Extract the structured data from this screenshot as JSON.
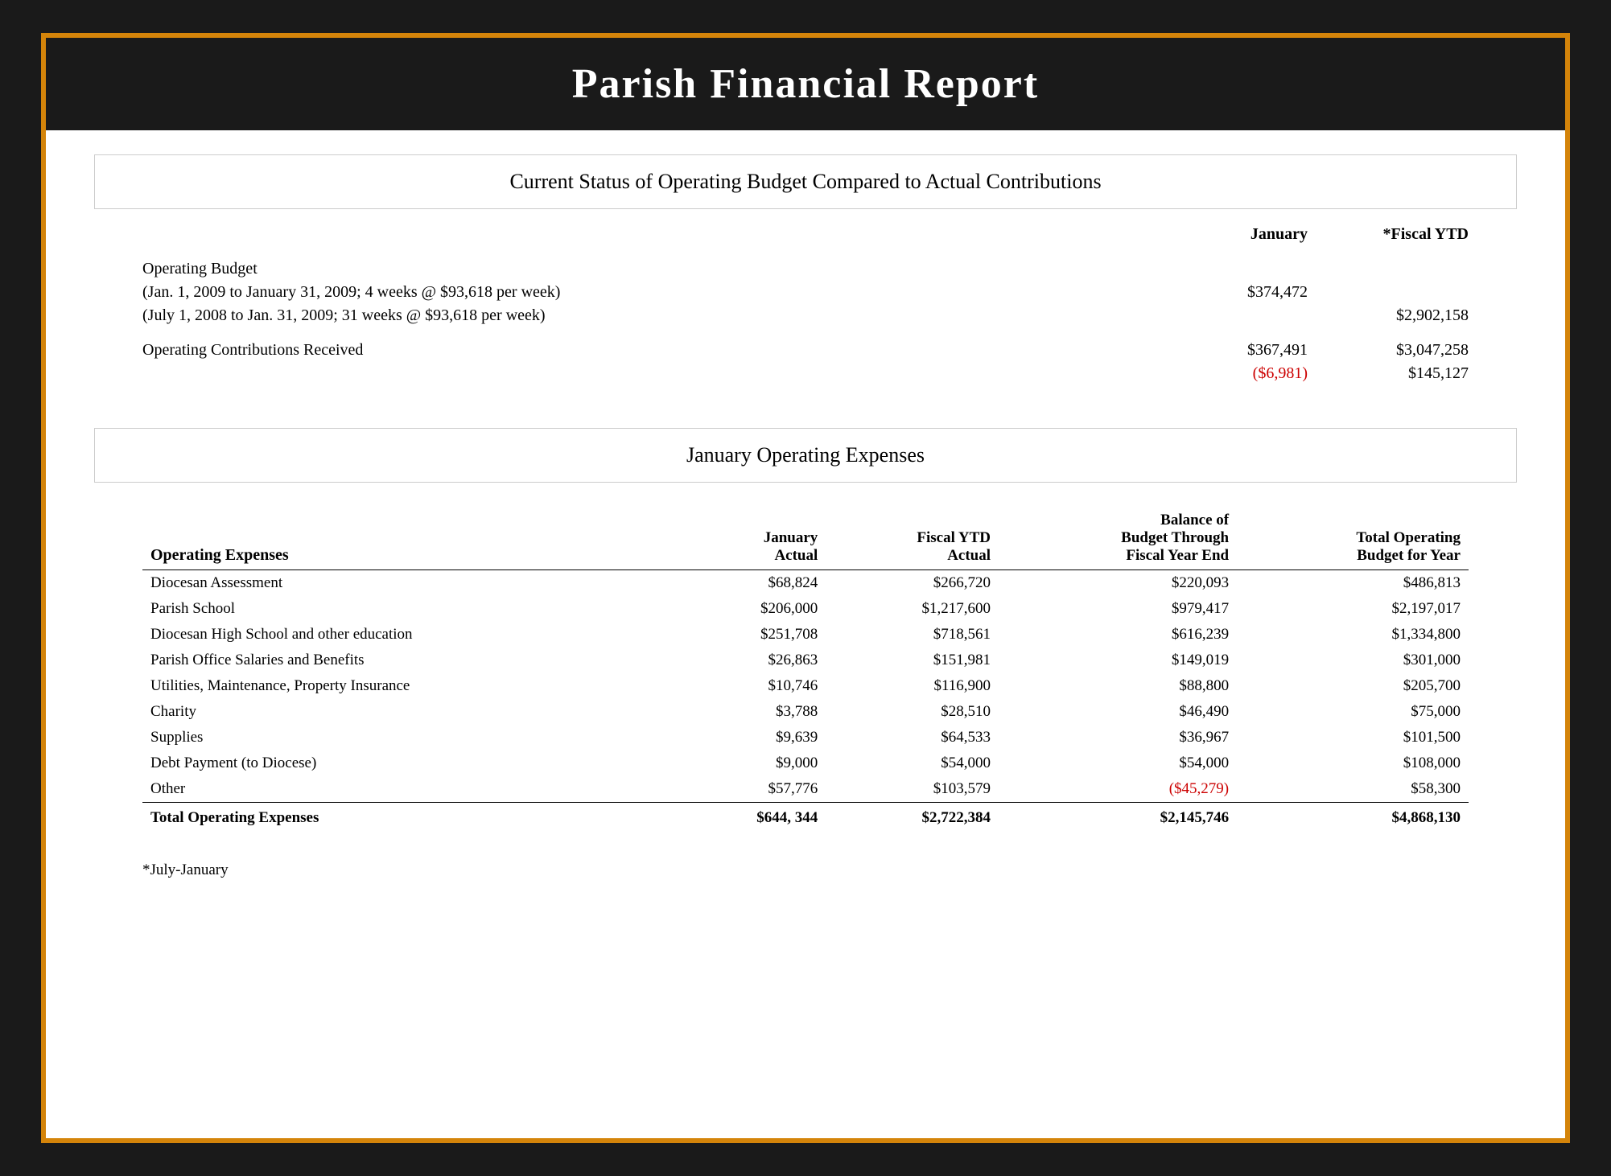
{
  "title": "Parish Financial Report",
  "section1": {
    "title": "Current Status of Operating Budget Compared to Actual Contributions",
    "col_jan": "January",
    "col_ytd": "*Fiscal YTD",
    "operating_budget_label": "Operating Budget",
    "op_line1": "(Jan. 1, 2009 to January 31, 2009; 4 weeks @ $93,618 per week)",
    "op_line1_jan": "$374,472",
    "op_line2": "(July 1, 2008 to Jan. 31, 2009; 31 weeks @ $93,618 per week)",
    "op_line2_ytd": "$2,902,158",
    "contrib_label": "Operating Contributions Received",
    "contrib_jan": "$367,491",
    "contrib_jan_diff": "($6,981)",
    "contrib_ytd": "$3,047,258",
    "contrib_ytd_diff": "$145,127"
  },
  "section2": {
    "title": "January Operating Expenses"
  },
  "expenses_table": {
    "col1": "Operating Expenses",
    "col2_line1": "January",
    "col2_line2": "Actual",
    "col3_line1": "Fiscal YTD",
    "col3_line2": "Actual",
    "col4_line1": "Balance of",
    "col4_line2": "Budget Through",
    "col4_line3": "Fiscal Year End",
    "col5_line1": "Total Operating",
    "col5_line2": "Budget for Year",
    "rows": [
      {
        "label": "Diocesan Assessment",
        "jan_actual": "$68,824",
        "fiscal_ytd": "$266,720",
        "balance": "$220,093",
        "total_budget": "$486,813",
        "balance_red": false
      },
      {
        "label": "Parish School",
        "jan_actual": "$206,000",
        "fiscal_ytd": "$1,217,600",
        "balance": "$979,417",
        "total_budget": "$2,197,017",
        "balance_red": false
      },
      {
        "label": "Diocesan High School and other education",
        "jan_actual": "$251,708",
        "fiscal_ytd": "$718,561",
        "balance": "$616,239",
        "total_budget": "$1,334,800",
        "balance_red": false
      },
      {
        "label": "Parish Office Salaries and Benefits",
        "jan_actual": "$26,863",
        "fiscal_ytd": "$151,981",
        "balance": "$149,019",
        "total_budget": "$301,000",
        "balance_red": false
      },
      {
        "label": "Utilities, Maintenance, Property Insurance",
        "jan_actual": "$10,746",
        "fiscal_ytd": "$116,900",
        "balance": "$88,800",
        "total_budget": "$205,700",
        "balance_red": false
      },
      {
        "label": "Charity",
        "jan_actual": "$3,788",
        "fiscal_ytd": "$28,510",
        "balance": "$46,490",
        "total_budget": "$75,000",
        "balance_red": false
      },
      {
        "label": "Supplies",
        "jan_actual": "$9,639",
        "fiscal_ytd": "$64,533",
        "balance": "$36,967",
        "total_budget": "$101,500",
        "balance_red": false
      },
      {
        "label": "Debt Payment (to Diocese)",
        "jan_actual": "$9,000",
        "fiscal_ytd": "$54,000",
        "balance": "$54,000",
        "total_budget": "$108,000",
        "balance_red": false
      },
      {
        "label": "Other",
        "jan_actual": "$57,776",
        "fiscal_ytd": "$103,579",
        "balance": "($45,279)",
        "total_budget": "$58,300",
        "balance_red": true
      }
    ],
    "total_label": "Total Operating Expenses",
    "total_jan": "$644, 344",
    "total_ytd": "$2,722,384",
    "total_balance": "$2,145,746",
    "total_budget": "$4,868,130"
  },
  "footnote": "*July-January"
}
